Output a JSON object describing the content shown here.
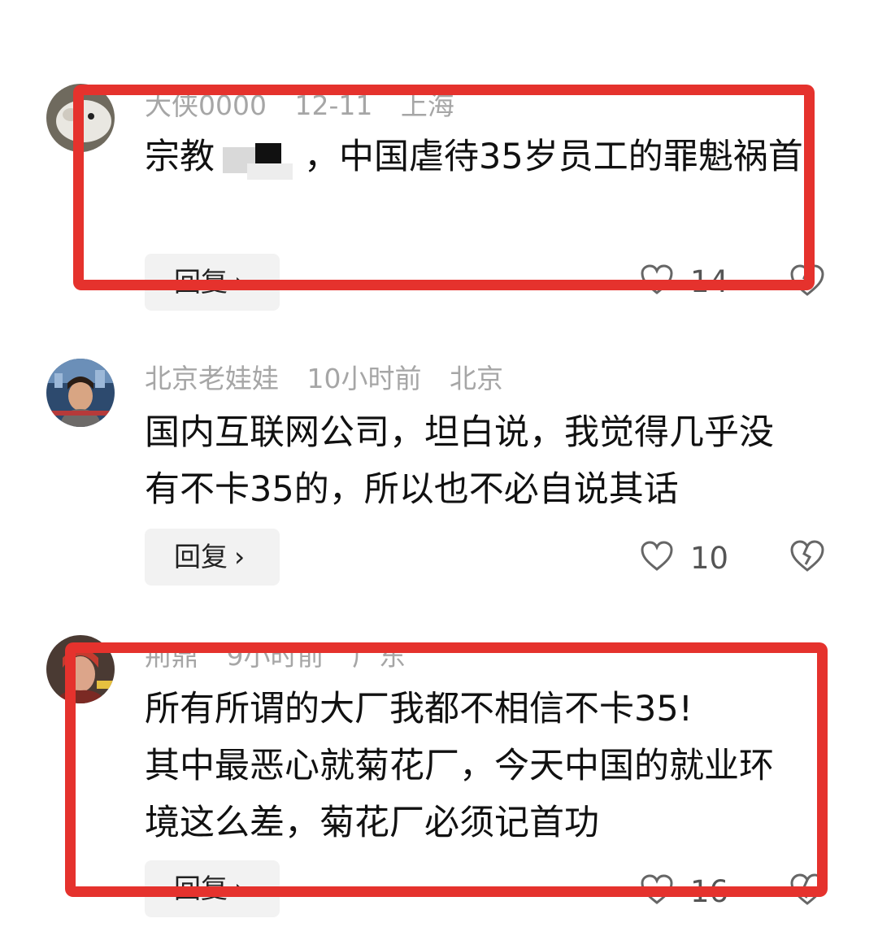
{
  "comments": [
    {
      "username": "大侠0000",
      "time": "12-11",
      "location": "上海",
      "text_before": "宗教",
      "text_after": "，中国虐待35岁员工的罪魁祸首",
      "reply_label": "回复",
      "like_count": "14"
    },
    {
      "username": "北京老娃娃",
      "time": "10小时前",
      "location": "北京",
      "text": "国内互联网公司，坦白说，我觉得几乎没有不卡35的，所以也不必自说其话",
      "reply_label": "回复",
      "like_count": "10"
    },
    {
      "username": "荊鼎",
      "time": "9小时前",
      "location": "广东",
      "text": "所有所谓的大厂我都不相信不卡35!\n其中最恶心就菊花厂，今天中国的就业环境这么差，菊花厂必须记首功",
      "reply_label": "回复",
      "like_count": "16"
    }
  ],
  "icons": {
    "like": "heart-outline-icon",
    "dislike": "broken-heart-icon",
    "reply_arrow": "chevron-right-icon"
  },
  "colors": {
    "highlight": "#e5322d",
    "meta_text": "#a6a6a6",
    "reply_bg": "#f2f2f2"
  }
}
